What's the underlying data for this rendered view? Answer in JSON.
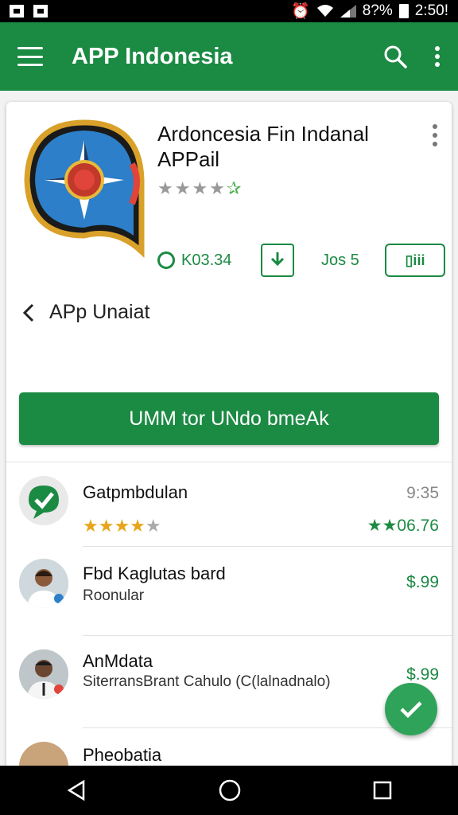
{
  "status_bar": {
    "battery": "8?%",
    "time": "2:50!"
  },
  "app_bar": {
    "title": "APP Indonesia",
    "icons": [
      "menu-icon",
      "search-icon",
      "more-vert-icon"
    ]
  },
  "app": {
    "name": "Ardoncesia Fin Indanal APPail",
    "rating_stars": "★★★★",
    "rating_extra": "✰",
    "size": "K03.34",
    "jos": "Jos 5",
    "ticket": "▯iii"
  },
  "back_row": {
    "label": "APp Unaiat"
  },
  "cta": {
    "label": "UMM tor UNdo bmeAk"
  },
  "list": [
    {
      "title": "Gatpmbdulan",
      "time": "9:35",
      "stars": "★★★★",
      "star_empty": "★",
      "price": "★★06.76"
    },
    {
      "title": "Fbd Kaglutas bard",
      "subtitle": "Roonular",
      "price": "$.99"
    },
    {
      "title": "AnMdata",
      "subtitle": "SiterransBrant Cahulo (C(lalnadnalo)",
      "price": "$.99"
    },
    {
      "title": "Pheobatia"
    }
  ],
  "colors": {
    "primary": "#1b8a43",
    "accent_star": "#e8a51b"
  }
}
